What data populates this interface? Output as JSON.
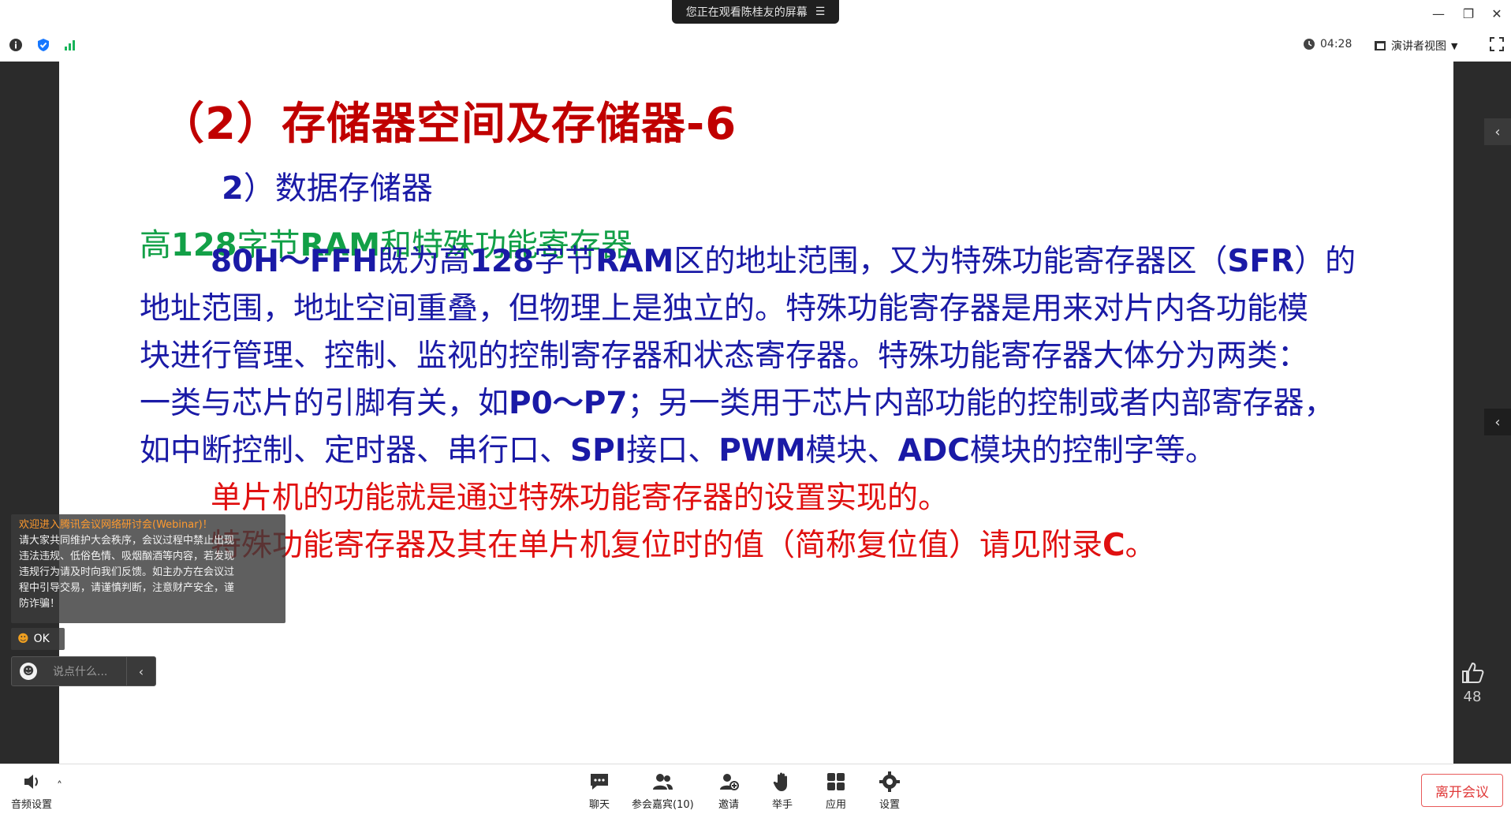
{
  "window": {
    "screen_share_banner": "您正在观看陈桂友的屏幕",
    "minimize": "—",
    "restore": "❐",
    "close": "✕"
  },
  "infobar": {
    "timer": "04:28",
    "view_mode": "演讲者视图"
  },
  "slide": {
    "title": "（2）存储器空间及存储器-6",
    "subhead": {
      "num": "2",
      "text": "）数据存储器"
    },
    "green_line": [
      {
        "t": "高",
        "b": false
      },
      {
        "t": "128",
        "b": true
      },
      {
        "t": "字节",
        "b": false
      },
      {
        "t": "RAM",
        "b": true
      },
      {
        "t": "和特殊功能寄存器",
        "b": false
      }
    ],
    "body_lines": [
      [
        {
          "t": "80H～FFH",
          "b": true
        },
        {
          "t": "既为高",
          "b": false
        },
        {
          "t": "128",
          "b": true
        },
        {
          "t": "字节",
          "b": false
        },
        {
          "t": "RAM",
          "b": true
        },
        {
          "t": "区的地址范围，又为特殊功能寄存器区（",
          "b": false
        },
        {
          "t": "SFR",
          "b": true
        },
        {
          "t": "）的",
          "b": false
        }
      ],
      [
        {
          "t": "地址范围，地址空间重叠，但物理上是独立的。特殊功能寄存器是用来对片内各功能模",
          "b": false
        }
      ],
      [
        {
          "t": "块进行管理、控制、监视的控制寄存器和状态寄存器。特殊功能寄存器大体分为两类：",
          "b": false
        }
      ],
      [
        {
          "t": "一类与芯片的引脚有关，如",
          "b": false
        },
        {
          "t": "P0～P7",
          "b": true
        },
        {
          "t": "；另一类用于芯片内部功能的控制或者内部寄存器，",
          "b": false
        }
      ],
      [
        {
          "t": "如中断控制、定时器、串行口、",
          "b": false
        },
        {
          "t": "SPI",
          "b": true
        },
        {
          "t": "接口、",
          "b": false
        },
        {
          "t": "PWM",
          "b": true
        },
        {
          "t": "模块、",
          "b": false
        },
        {
          "t": "ADC",
          "b": true
        },
        {
          "t": "模块的控制字等。",
          "b": false
        }
      ]
    ],
    "red_lines": [
      [
        {
          "t": "单片机的功能就是通过特殊功能寄存器的设置实现的。",
          "b": false
        }
      ],
      [
        {
          "t": "特殊功能寄存器及其在单片机复位时的值（简称复位值）请见附录",
          "b": false
        },
        {
          "t": "C",
          "b": true
        },
        {
          "t": "。",
          "b": false
        }
      ]
    ]
  },
  "chat": {
    "notice_title": "欢迎进入腾讯会议网络研讨会(Webinar)！",
    "notice_body": [
      "请大家共同维护大会秩序，会议过程中禁止出现",
      "违法违规、低俗色情、吸烟酗酒等内容，若发现",
      "违规行为请及时向我们反馈。如主办方在会议过",
      "程中引导交易，请谨慎判断，注意财产安全，谨",
      "防诈骗！"
    ],
    "ok_message": "OK",
    "input_placeholder": "说点什么..."
  },
  "reactions": {
    "like_count": "48"
  },
  "toolbar": {
    "audio_settings": "音频设置",
    "chat": "聊天",
    "participants": "参会嘉宾(10)",
    "invite": "邀请",
    "raise_hand": "举手",
    "apps": "应用",
    "settings": "设置",
    "leave": "离开会议"
  },
  "colors": {
    "title_red": "#c00000",
    "body_blue": "#1a1aa6",
    "green": "#12a047",
    "red": "#e01010",
    "notice_orange": "#ff9a2e"
  }
}
